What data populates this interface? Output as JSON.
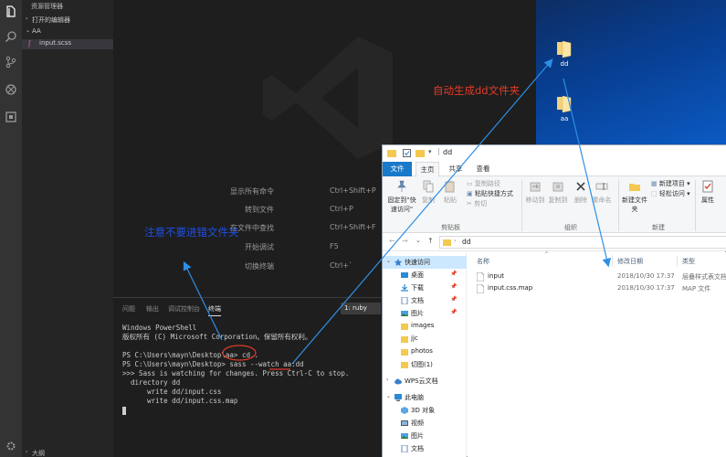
{
  "vscode": {
    "explorer": {
      "title": "资源管理器",
      "open_editors": "打开的编辑器",
      "folder": "AA",
      "file": "input.scss",
      "outline": "大纲"
    },
    "shortcuts": [
      {
        "label": "显示所有命令",
        "key": "Ctrl+Shift+P"
      },
      {
        "label": "转到文件",
        "key": "Ctrl+P"
      },
      {
        "label": "在文件中查找",
        "key": "Ctrl+Shift+F"
      },
      {
        "label": "开始调试",
        "key": "F5"
      },
      {
        "label": "切换终端",
        "key": "Ctrl+`"
      }
    ],
    "panel": {
      "tabs": [
        "问题",
        "输出",
        "调试控制台",
        "终端"
      ],
      "terminal_select": "1: ruby",
      "lines": [
        "Windows PowerShell",
        "版权所有 (C) Microsoft Corporation。保留所有权利。",
        "",
        "PS C:\\Users\\mayn\\Desktop\\aa> cd..",
        "PS C:\\Users\\mayn\\Desktop> sass --watch aa:dd",
        ">>> Sass is watching for changes. Press Ctrl-C to stop.",
        "  directory dd",
        "      write dd/input.css",
        "      write dd/input.css.map"
      ]
    }
  },
  "annotations": {
    "no_wrong_folder": "注意不要进错文件夹",
    "auto_created": "自动生成dd文件夹",
    "annotation_color": "#1f4fe0",
    "annotation_red": "#e23a2a",
    "arrow_color": "#2f8fe6"
  },
  "desktop": {
    "icons": [
      "dd",
      "aa"
    ]
  },
  "file_explorer": {
    "title": "dd",
    "menu": [
      "文件",
      "主页",
      "共享",
      "查看"
    ],
    "ribbon": {
      "pin_quick": "固定到\"快速访问\"",
      "copy": "复制",
      "paste": "粘贴",
      "copy_path": "复制路径",
      "paste_shortcut": "粘贴快捷方式",
      "cut": "剪切",
      "clipboard": "剪贴板",
      "move_to": "移动到",
      "copy_to": "复制到",
      "delete": "删除",
      "rename": "重命名",
      "organize": "组织",
      "new_folder": "新建文件夹",
      "new_item": "新建项目",
      "easy_access": "轻松访问",
      "new": "新建",
      "properties": "属性"
    },
    "address": "dd",
    "nav": {
      "quick_access": "快速访问",
      "items": [
        "桌面",
        "下载",
        "文档",
        "图片",
        "images",
        "jjc",
        "photos",
        "切图(1)"
      ],
      "wps": "WPS云文档",
      "this_pc": "此电脑",
      "pc_items": [
        "3D 对象",
        "视频",
        "图片",
        "文档"
      ]
    },
    "columns": [
      "名称",
      "修改日期",
      "类型"
    ],
    "files": [
      {
        "name": "input",
        "date": "2018/10/30 17:37",
        "type": "层叠样式表文档"
      },
      {
        "name": "input.css.map",
        "date": "2018/10/30 17:37",
        "type": "MAP 文件"
      }
    ]
  }
}
